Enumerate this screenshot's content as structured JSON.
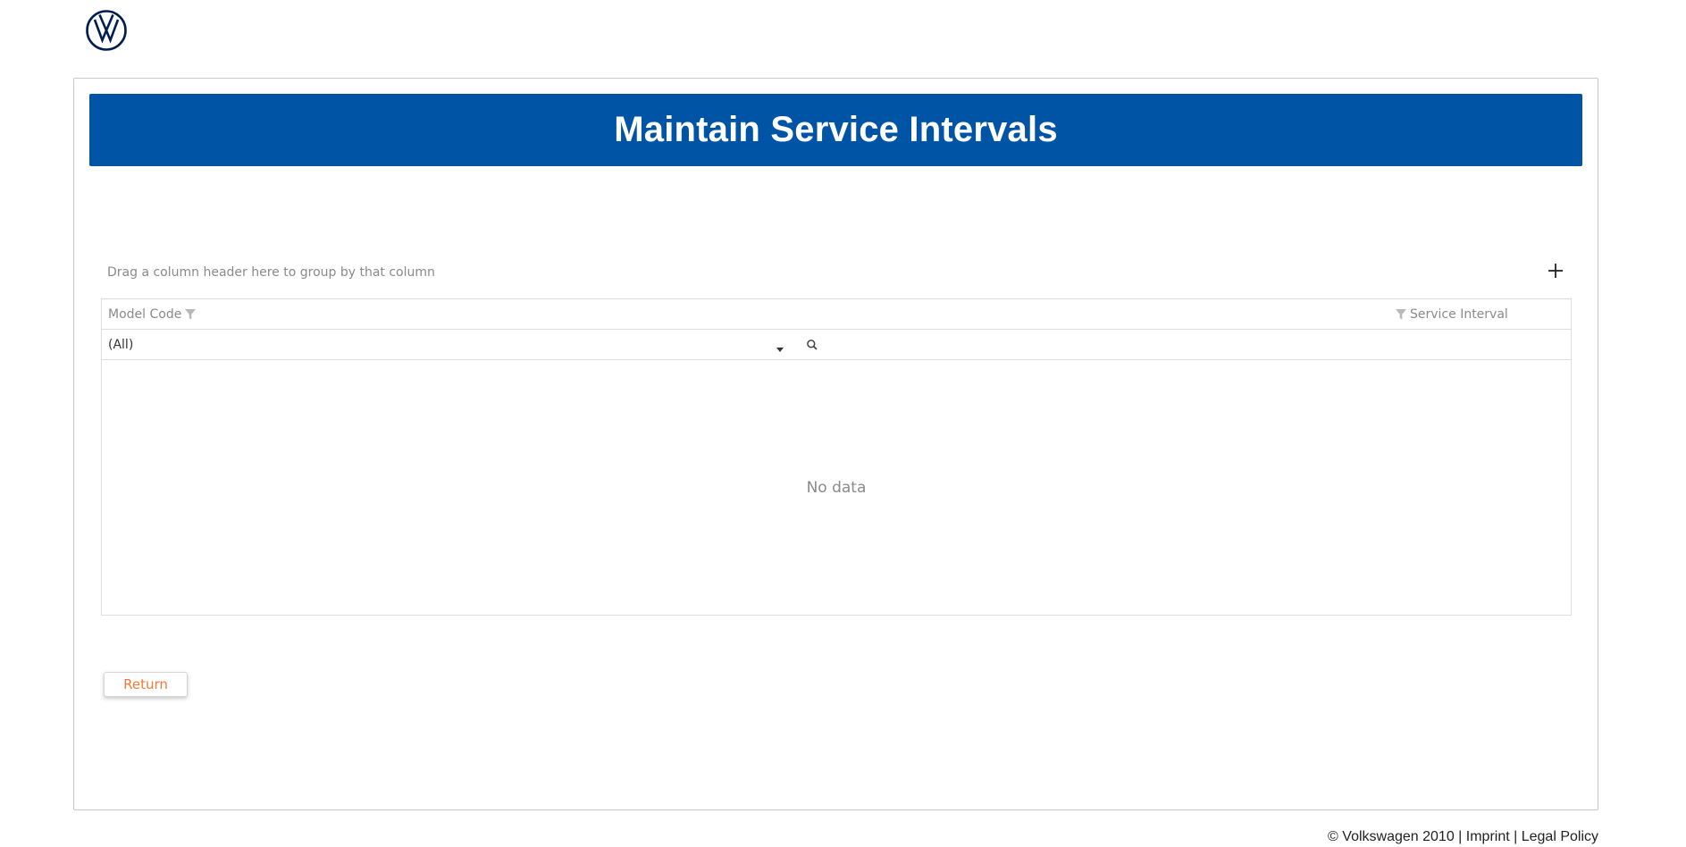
{
  "brand": {
    "logo_icon": "vw-logo-icon",
    "logo_color": "#001e50"
  },
  "header": {
    "title": "Maintain Service Intervals",
    "background_color": "#0054a6"
  },
  "grid": {
    "group_panel_hint": "Drag a column header here to group by that column",
    "add_icon": "plus-icon",
    "columns": [
      {
        "label": "Model Code",
        "icon": "filter-icon"
      },
      {
        "label": "Service Interval",
        "icon": "filter-icon"
      }
    ],
    "filter": {
      "model_code_selected": "(All)",
      "search_placeholder": "",
      "search_value": ""
    },
    "empty_message": "No data"
  },
  "actions": {
    "return_label": "Return",
    "return_color": "#f07b3a"
  },
  "footer": {
    "copyright": "© Volkswagen 2010",
    "separator": " | ",
    "imprint_label": "Imprint",
    "legal_label": "Legal Policy"
  }
}
